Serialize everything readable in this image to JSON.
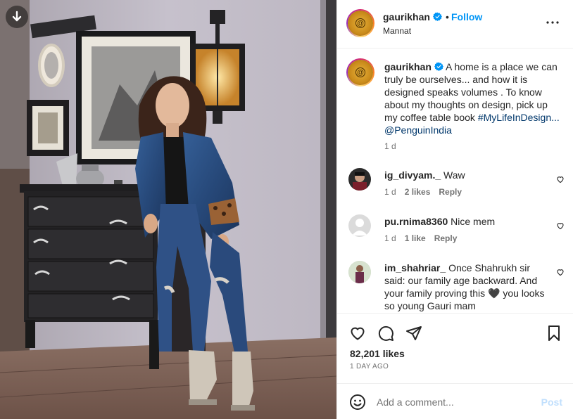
{
  "post": {
    "username": "gaurikhan",
    "follow_label": "Follow",
    "separator": "•",
    "location": "Mannat",
    "verified_color": "#0095f6"
  },
  "caption": {
    "username": "gaurikhan",
    "text": "A home is a place we can truly be ourselves... and how it is designed speaks volumes . To know about my thoughts on design, pick up my coffee table book",
    "hashtag": "#MyLifeInDesign...",
    "mention": "@PenguinIndia",
    "time": "1 d"
  },
  "comments": [
    {
      "username": "ig_divyam._",
      "text": "Waw",
      "time": "1 d",
      "likes": "2 likes",
      "reply_label": "Reply"
    },
    {
      "username": "pu.rnima8360",
      "text": "Nice mem",
      "time": "1 d",
      "likes": "1 like",
      "reply_label": "Reply"
    },
    {
      "username": "im_shahriar_",
      "text": "Once Shahrukh sir said: our family age backward. And your family proving this 🖤 you looks so young Gauri mam"
    }
  ],
  "actions": {
    "likes": "82,201 likes",
    "time": "1 DAY AGO"
  },
  "add_comment": {
    "placeholder": "Add a comment...",
    "post_label": "Post"
  },
  "icons": [
    "download-icon",
    "verified-icon",
    "more-icon",
    "heart-icon",
    "comment-icon",
    "share-icon",
    "bookmark-icon",
    "emoji-icon"
  ]
}
